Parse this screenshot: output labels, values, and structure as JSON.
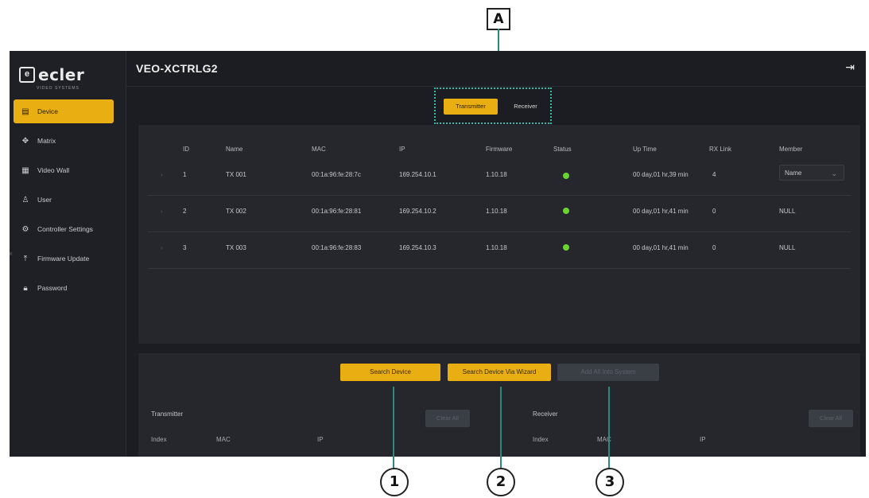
{
  "callouts": {
    "a": "A",
    "n1": "1",
    "n2": "2",
    "n3": "3"
  },
  "brand": {
    "logo_text": "ecler",
    "logo_mark": "e",
    "logo_sub": "VIDEO SYSTEMS"
  },
  "header": {
    "title": "VEO-XCTRLG2",
    "logout_icon": "logout-icon"
  },
  "sidebar": {
    "items": [
      {
        "label": "Device",
        "icon": "device-icon",
        "active": true
      },
      {
        "label": "Matrix",
        "icon": "matrix-icon"
      },
      {
        "label": "Video Wall",
        "icon": "videowall-icon"
      },
      {
        "label": "User",
        "icon": "user-icon"
      },
      {
        "label": "Controller Settings",
        "icon": "gear-icon"
      },
      {
        "label": "Firmware Update",
        "icon": "upload-icon"
      },
      {
        "label": "Password",
        "icon": "lock-icon"
      }
    ]
  },
  "tabs": {
    "transmitter": "Transmitter",
    "receiver": "Receiver"
  },
  "table": {
    "headers": [
      "ID",
      "Name",
      "MAC",
      "IP",
      "Firmware",
      "Status",
      "Up Time",
      "RX Link",
      "Member"
    ],
    "rows": [
      {
        "id": "1",
        "name": "TX 001",
        "mac": "00:1a:96:fe:28:7c",
        "ip": "169.254.10.1",
        "firmware": "1.10.18",
        "uptime": "00 day,01 hr,39 min",
        "rxlink": "4",
        "member": "Name"
      },
      {
        "id": "2",
        "name": "TX 002",
        "mac": "00:1a:96:fe:28:81",
        "ip": "169.254.10.2",
        "firmware": "1.10.18",
        "uptime": "00 day,01 hr,41 min",
        "rxlink": "0",
        "member": "NULL"
      },
      {
        "id": "3",
        "name": "TX 003",
        "mac": "00:1a:96:fe:28:83",
        "ip": "169.254.10.3",
        "firmware": "1.10.18",
        "uptime": "00 day,01 hr,41 min",
        "rxlink": "0",
        "member": "NULL"
      }
    ],
    "status_color": "#6bd330"
  },
  "actions": {
    "search": "Search Device",
    "wizard": "Search Device Via Wizard",
    "add_all": "Add All Into System"
  },
  "lists": {
    "transmitter": {
      "label": "Transmitter",
      "clear": "Clear All",
      "index": "Index",
      "mac": "MAC",
      "ip": "IP"
    },
    "receiver": {
      "label": "Receiver",
      "clear": "Clear All",
      "index": "Index",
      "mac": "MAC",
      "ip": "IP"
    }
  },
  "colors": {
    "accent": "#e8ae12",
    "background": "#1b1d22",
    "panel": "#25272c",
    "callout_line": "#2d8a7a"
  }
}
